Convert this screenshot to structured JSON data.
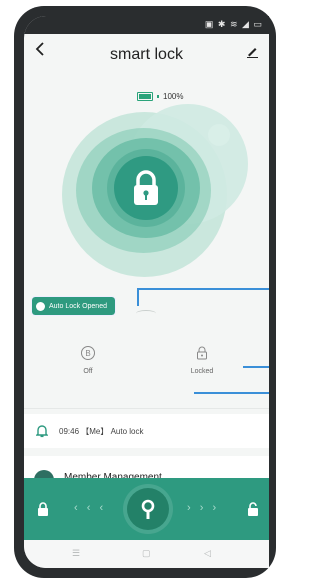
{
  "app": {
    "title": "smart lock"
  },
  "status_bar": {
    "icons": [
      "nfc-icon",
      "bluetooth-icon",
      "wifi-icon",
      "signal-icon",
      "battery-icon"
    ]
  },
  "battery": {
    "percent_label": "100%",
    "level": 1.0,
    "color": "#2aa37a"
  },
  "lock_state_badge": {
    "label": "Auto Lock Opened"
  },
  "stats": [
    {
      "icon": "clock-b-icon",
      "label": "Off"
    },
    {
      "icon": "lock-status-icon",
      "label": "Locked"
    }
  ],
  "log": {
    "icon": "bell-icon",
    "text": "09:46 【Me】 Auto lock"
  },
  "member": {
    "label": "Member Management"
  },
  "slider": {
    "left_icon": "lock-closed-icon",
    "center_icon": "key-icon",
    "right_icon": "lock-open-icon",
    "color": "#2e9a80"
  },
  "colors": {
    "accent": "#2e9a80",
    "annotation": "#3a8fd8"
  }
}
